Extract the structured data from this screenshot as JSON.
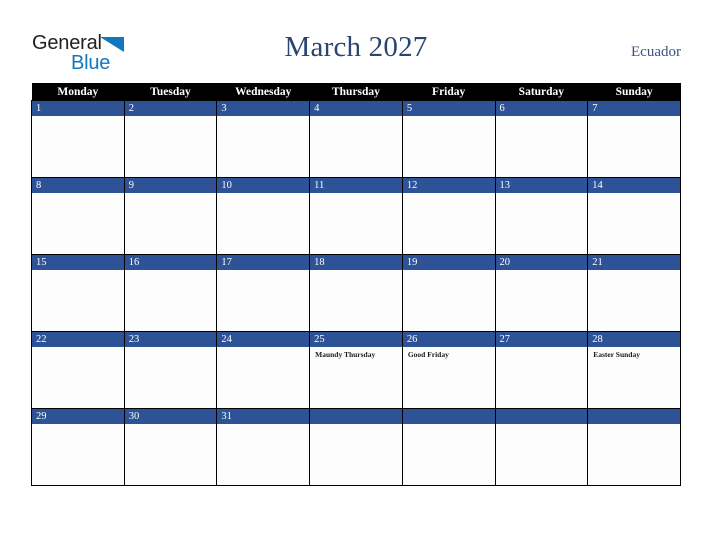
{
  "brand": {
    "name_part1": "General",
    "name_part2": "Blue",
    "color_dark": "#231f20",
    "color_blue": "#1278be"
  },
  "header": {
    "title": "March 2027",
    "country": "Ecuador",
    "title_color": "#2b4570"
  },
  "calendar": {
    "accent_color": "#2d5396",
    "header_bg": "#000000",
    "weekday_headers": [
      "Monday",
      "Tuesday",
      "Wednesday",
      "Thursday",
      "Friday",
      "Saturday",
      "Sunday"
    ],
    "weeks": [
      [
        {
          "date": "1",
          "events": []
        },
        {
          "date": "2",
          "events": []
        },
        {
          "date": "3",
          "events": []
        },
        {
          "date": "4",
          "events": []
        },
        {
          "date": "5",
          "events": []
        },
        {
          "date": "6",
          "events": []
        },
        {
          "date": "7",
          "events": []
        }
      ],
      [
        {
          "date": "8",
          "events": []
        },
        {
          "date": "9",
          "events": []
        },
        {
          "date": "10",
          "events": []
        },
        {
          "date": "11",
          "events": []
        },
        {
          "date": "12",
          "events": []
        },
        {
          "date": "13",
          "events": []
        },
        {
          "date": "14",
          "events": []
        }
      ],
      [
        {
          "date": "15",
          "events": []
        },
        {
          "date": "16",
          "events": []
        },
        {
          "date": "17",
          "events": []
        },
        {
          "date": "18",
          "events": []
        },
        {
          "date": "19",
          "events": []
        },
        {
          "date": "20",
          "events": []
        },
        {
          "date": "21",
          "events": []
        }
      ],
      [
        {
          "date": "22",
          "events": []
        },
        {
          "date": "23",
          "events": []
        },
        {
          "date": "24",
          "events": []
        },
        {
          "date": "25",
          "events": [
            "Maundy Thursday"
          ]
        },
        {
          "date": "26",
          "events": [
            "Good Friday"
          ]
        },
        {
          "date": "27",
          "events": []
        },
        {
          "date": "28",
          "events": [
            "Easter Sunday"
          ]
        }
      ],
      [
        {
          "date": "29",
          "events": []
        },
        {
          "date": "30",
          "events": []
        },
        {
          "date": "31",
          "events": []
        },
        {
          "date": "",
          "events": []
        },
        {
          "date": "",
          "events": []
        },
        {
          "date": "",
          "events": []
        },
        {
          "date": "",
          "events": []
        }
      ]
    ]
  }
}
